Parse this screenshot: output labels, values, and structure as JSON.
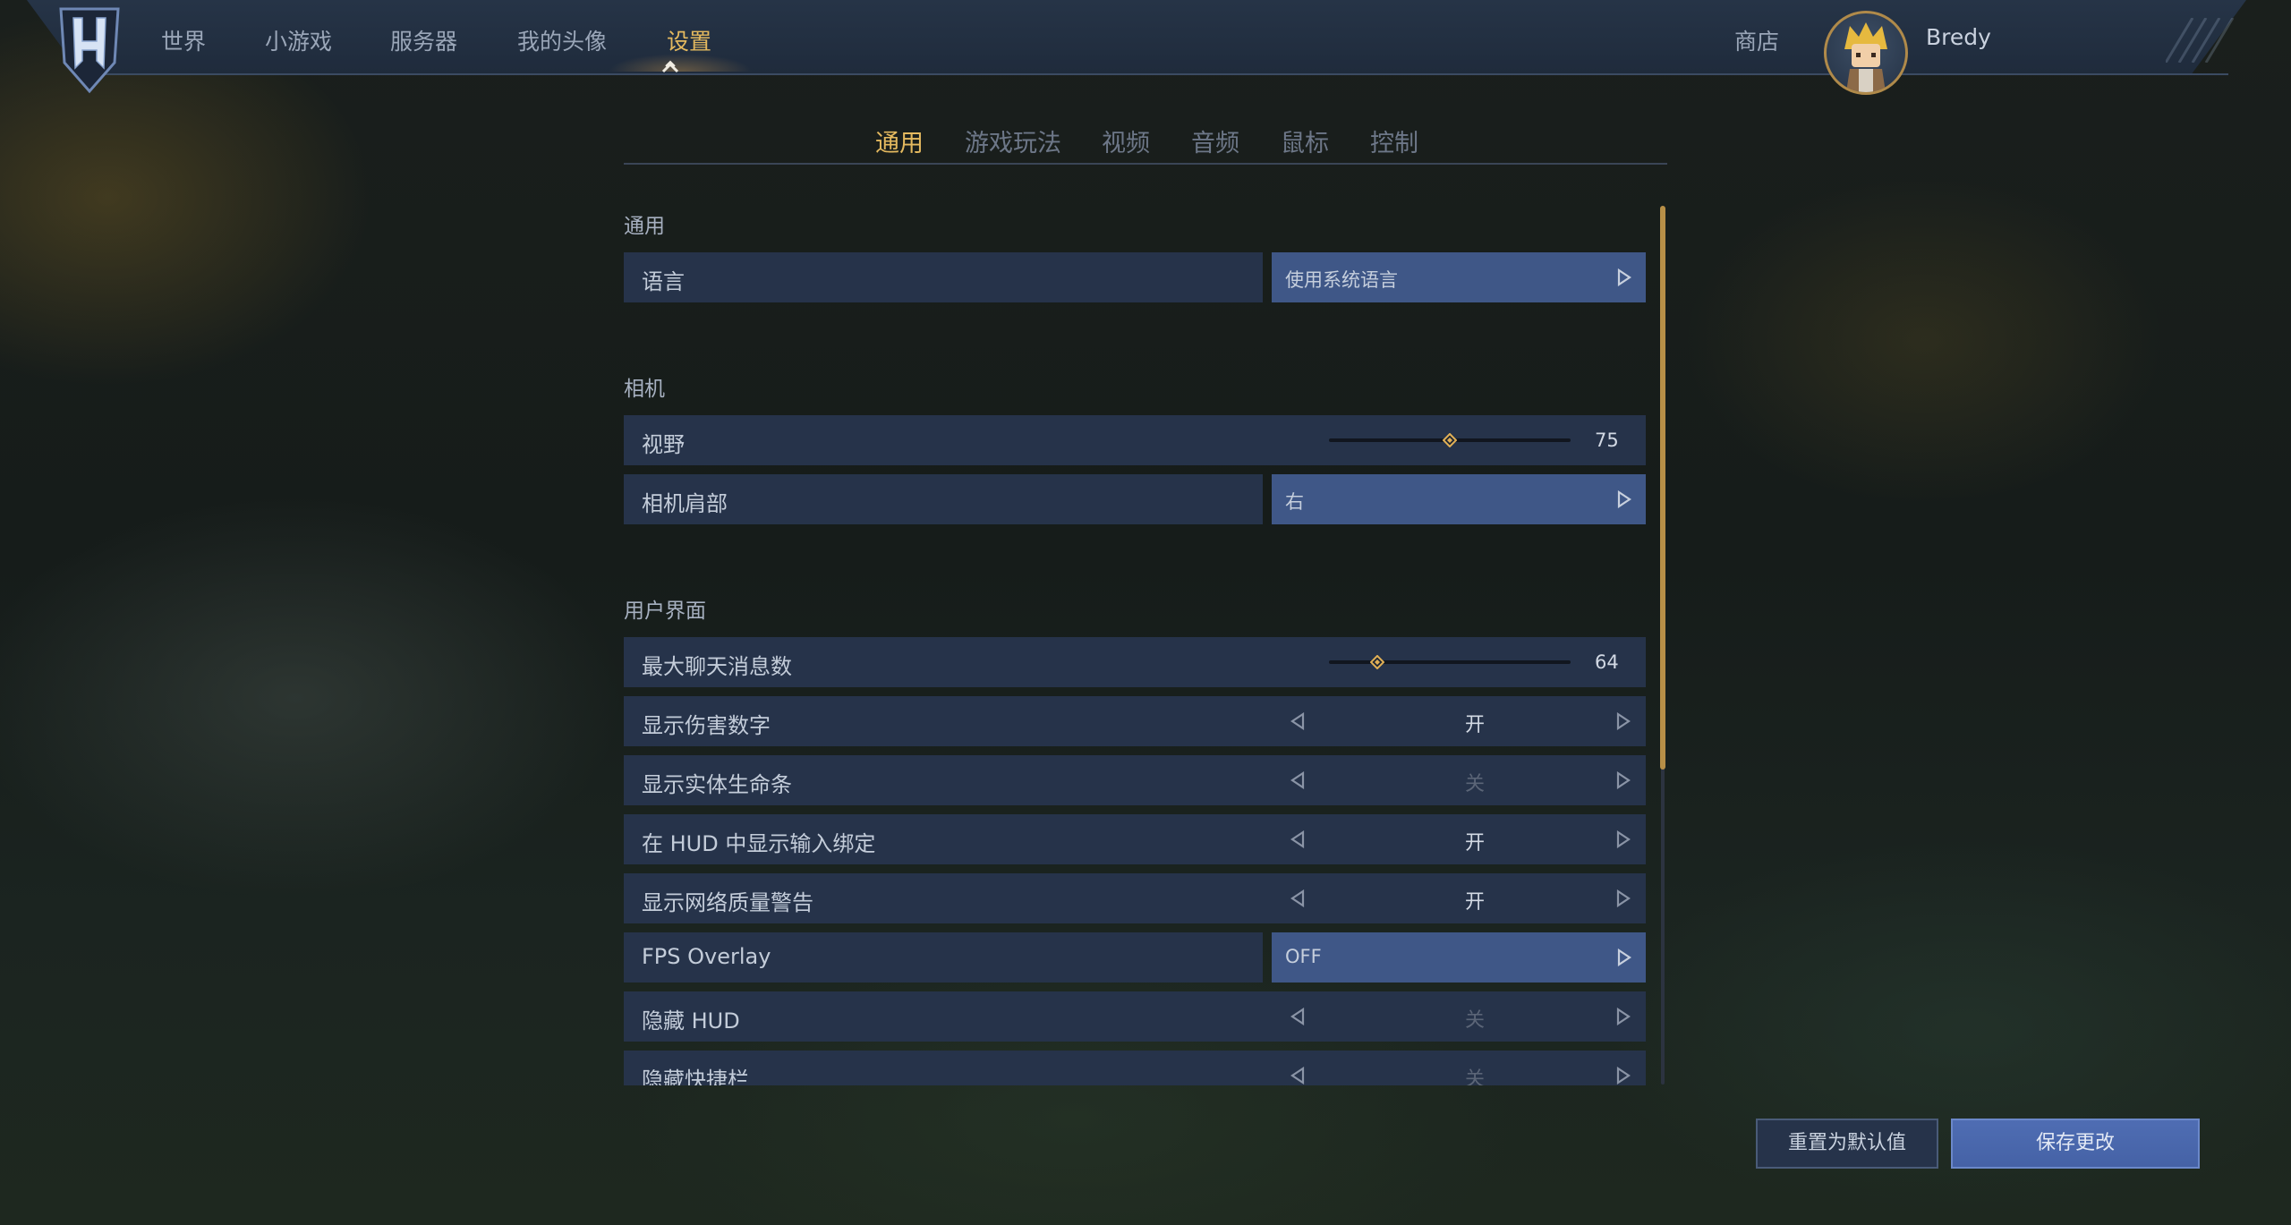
{
  "topbar": {
    "nav": [
      "世界",
      "小游戏",
      "服务器",
      "我的头像",
      "设置"
    ],
    "active_nav": "设置",
    "shop": "商店",
    "username": "Bredy"
  },
  "tabs": [
    "通用",
    "游戏玩法",
    "视频",
    "音频",
    "鼠标",
    "控制"
  ],
  "active_tab": "通用",
  "sections": {
    "general": {
      "title": "通用",
      "language": {
        "label": "语言",
        "value": "使用系统语言"
      }
    },
    "camera": {
      "title": "相机",
      "fov": {
        "label": "视野",
        "value": "75",
        "fraction": 0.5
      },
      "shoulder": {
        "label": "相机肩部",
        "value": "右"
      }
    },
    "ui": {
      "title": "用户界面",
      "max_chat": {
        "label": "最大聊天消息数",
        "value": "64",
        "fraction": 0.2
      },
      "damage_numbers": {
        "label": "显示伤害数字",
        "value": "开",
        "enabled": true
      },
      "health_bars": {
        "label": "显示实体生命条",
        "value": "关",
        "enabled": false
      },
      "input_bindings": {
        "label": "在 HUD 中显示输入绑定",
        "value": "开",
        "enabled": true
      },
      "network_warning": {
        "label": "显示网络质量警告",
        "value": "开",
        "enabled": true
      },
      "fps_overlay": {
        "label": "FPS Overlay",
        "value": "OFF"
      },
      "hide_hud": {
        "label": "隐藏 HUD",
        "value": "关",
        "enabled": false
      },
      "hide_hotbar": {
        "label": "隐藏快捷栏",
        "value": "关",
        "enabled": false
      }
    }
  },
  "buttons": {
    "reset": "重置为默认值",
    "save": "保存更改"
  }
}
